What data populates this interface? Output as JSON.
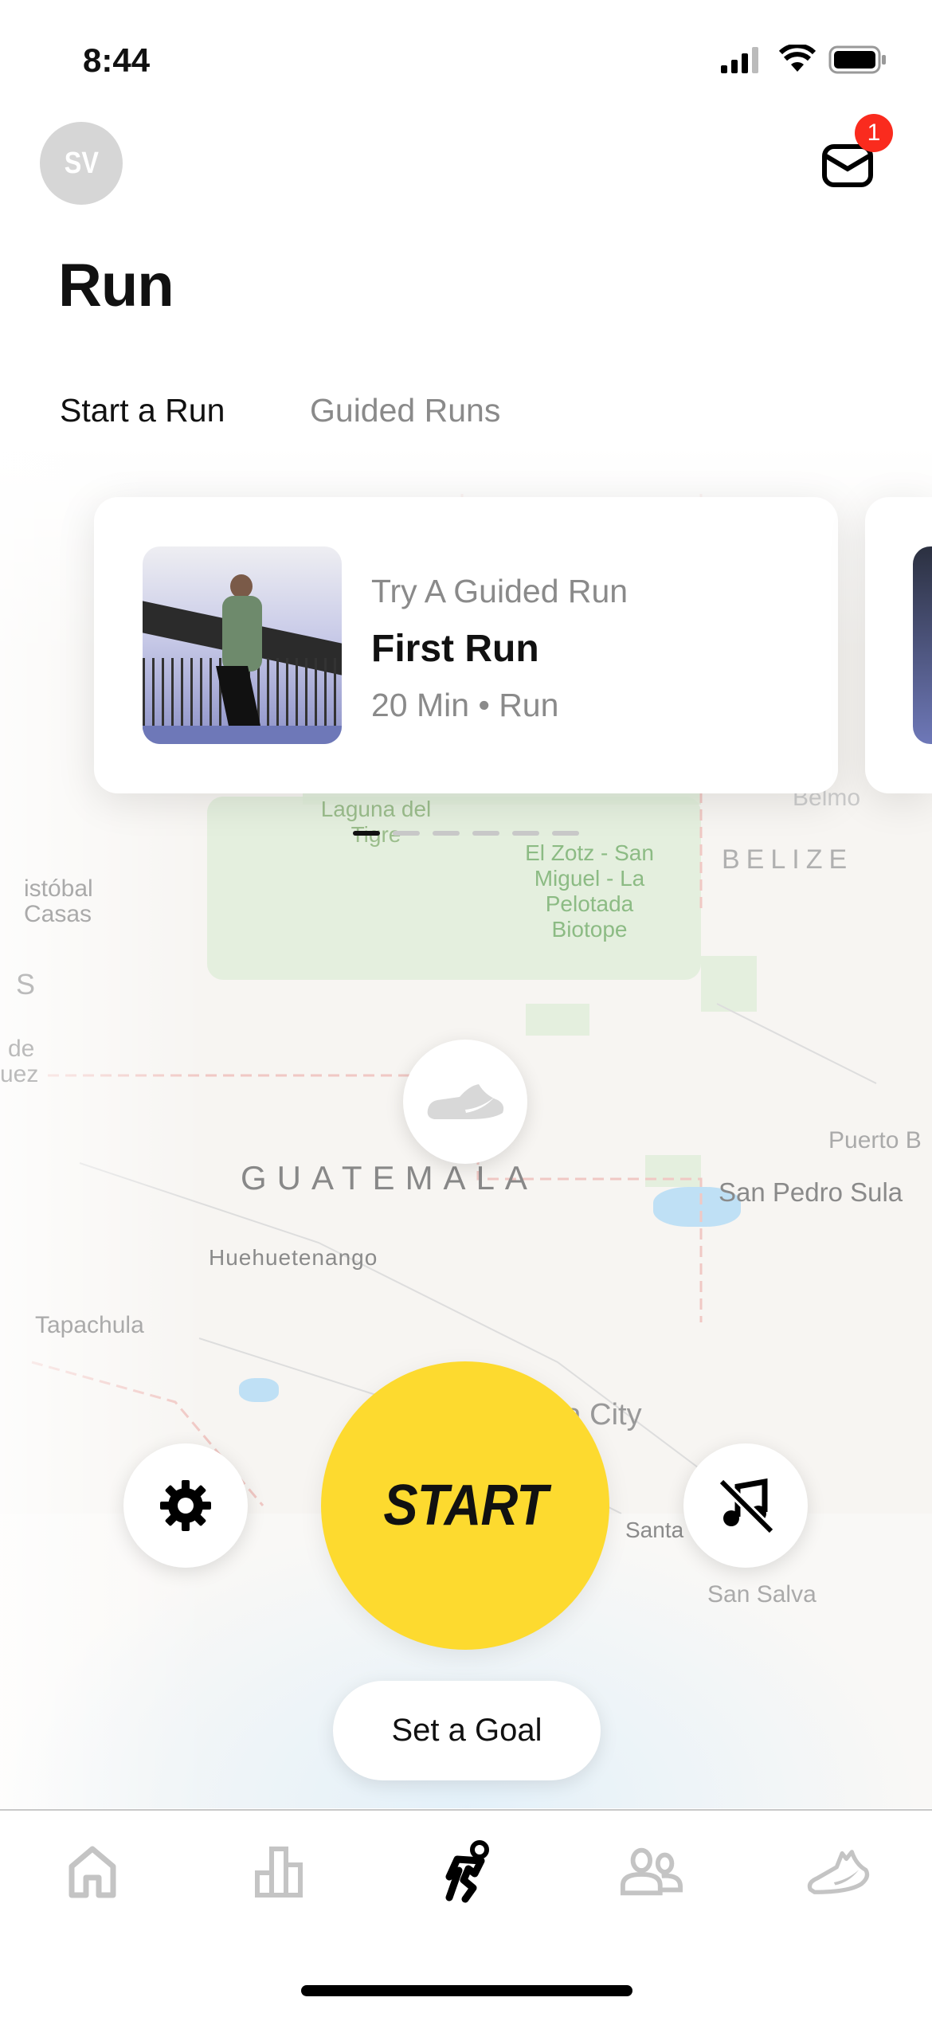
{
  "status_bar": {
    "time": "8:44"
  },
  "header": {
    "avatar_initials": "SV",
    "inbox_badge": "1",
    "title": "Run"
  },
  "tabs": [
    {
      "label": "Start a Run",
      "active": true
    },
    {
      "label": "Guided Runs",
      "active": false
    }
  ],
  "guided_card": {
    "eyebrow": "Try A Guided Run",
    "title": "First Run",
    "meta": "20 Min • Run"
  },
  "carousel": {
    "pages": 6,
    "current": 1
  },
  "map": {
    "labels": {
      "laguna": "Laguna del Tigre",
      "zotz": "El Zotz - San Miguel - La Pelotada Biotope",
      "belize": "BELIZE",
      "belmo": "Belmo",
      "cristobal": "istóbal Casas",
      "guatemala": "GUATEMALA",
      "huehue": "Huehuetenango",
      "tapachula": "Tapachula",
      "puerto": "Puerto B",
      "sanpedro": "San Pedro Sula",
      "city": "la City",
      "santa": "Santa",
      "sansalv": "San Salva",
      "s": "S",
      "de": "de",
      "uez": "uez"
    }
  },
  "controls": {
    "start_label": "START",
    "goal_label": "Set a Goal"
  },
  "bottom_nav": [
    {
      "icon": "home-icon",
      "active": false
    },
    {
      "icon": "activity-icon",
      "active": false
    },
    {
      "icon": "run-icon",
      "active": true
    },
    {
      "icon": "club-icon",
      "active": false
    },
    {
      "icon": "shoe-icon",
      "active": false
    }
  ],
  "colors": {
    "start": "#FDDA2F",
    "badge": "#FA2B1E",
    "inactive": "#c4c4c4"
  }
}
